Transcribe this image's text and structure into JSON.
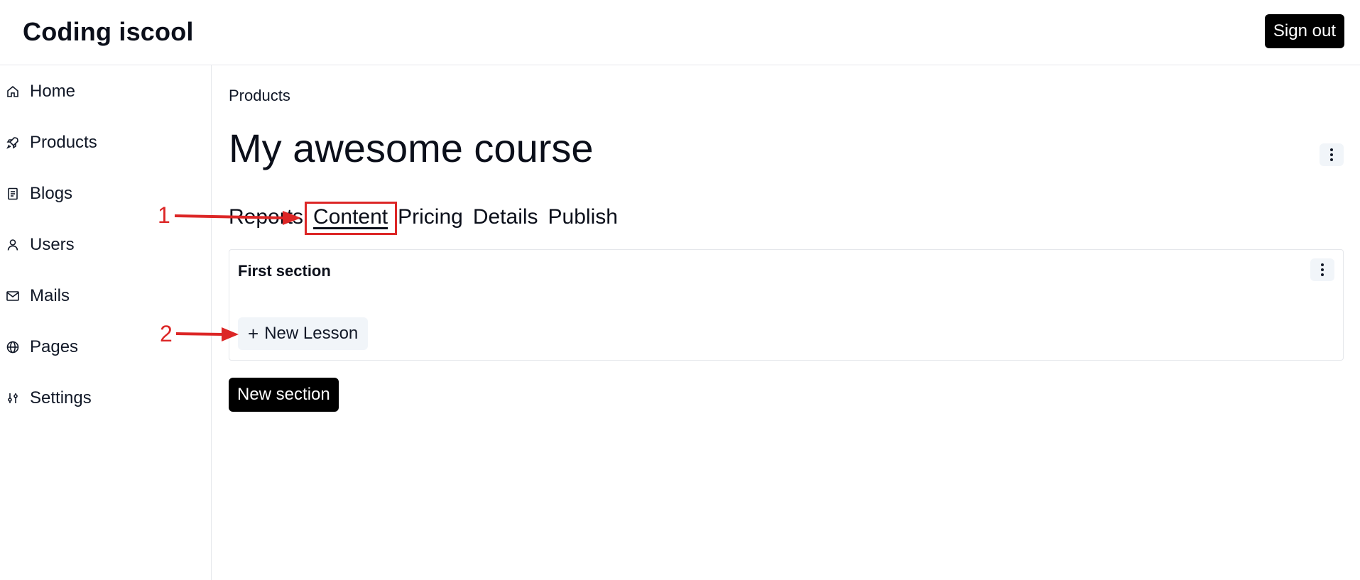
{
  "header": {
    "brand": "Coding iscool",
    "signout_label": "Sign out"
  },
  "sidebar": {
    "items": [
      {
        "label": "Home",
        "icon": "home-icon"
      },
      {
        "label": "Products",
        "icon": "rocket-icon"
      },
      {
        "label": "Blogs",
        "icon": "document-icon"
      },
      {
        "label": "Users",
        "icon": "user-icon"
      },
      {
        "label": "Mails",
        "icon": "mail-icon"
      },
      {
        "label": "Pages",
        "icon": "globe-icon"
      },
      {
        "label": "Settings",
        "icon": "sliders-icon"
      }
    ]
  },
  "main": {
    "breadcrumb": "Products",
    "title": "My awesome course",
    "tabs": [
      {
        "label": "Reports"
      },
      {
        "label": "Content",
        "active": true
      },
      {
        "label": "Pricing"
      },
      {
        "label": "Details"
      },
      {
        "label": "Publish"
      }
    ],
    "section": {
      "title": "First section",
      "new_lesson_label": "New Lesson"
    },
    "new_section_label": "New section"
  },
  "annotations": {
    "step1": "1",
    "step2": "2",
    "color": "#dc2626"
  }
}
